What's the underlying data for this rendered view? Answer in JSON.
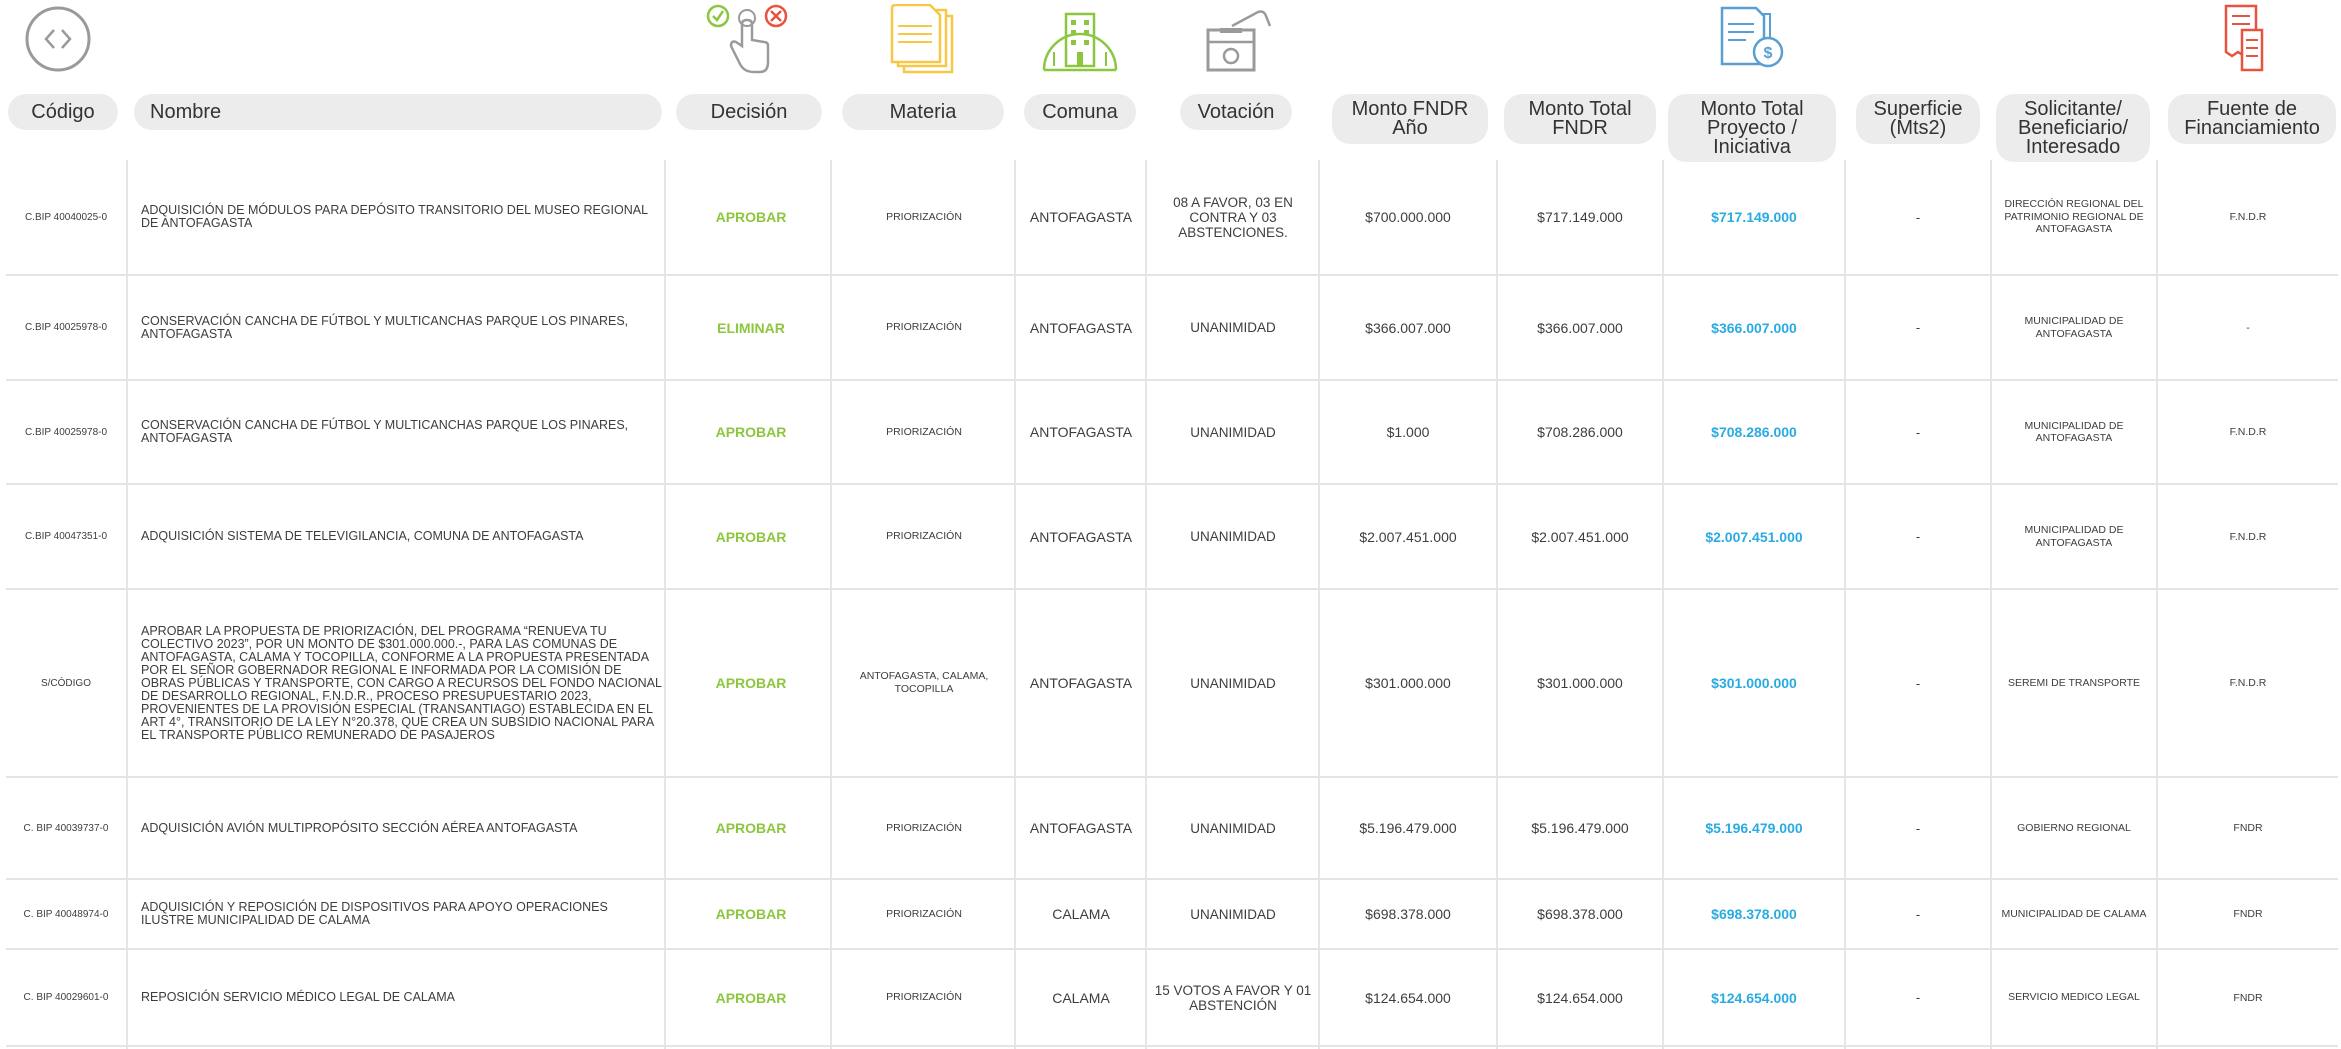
{
  "colors": {
    "decision": "#8cc63f",
    "total": "#29abe2",
    "pill": "#ececec",
    "icon_grey": "#9a9a9a",
    "icon_yellow": "#f7c846",
    "icon_green": "#8cc63f",
    "icon_blue": "#5a9fd4",
    "icon_red": "#e8533f"
  },
  "icons": [
    "code-brackets-icon",
    "decision-hand-icon",
    "documents-icon",
    "building-icon",
    "ballot-box-icon",
    "money-document-icon",
    "receipt-icon"
  ],
  "headers": {
    "codigo": "Código",
    "nombre": "Nombre",
    "decision": "Decisión",
    "materia": "Materia",
    "comuna": "Comuna",
    "votacion": "Votación",
    "monto_anio": "Monto FNDR\nAño",
    "monto_total": "Monto Total\nFNDR",
    "monto_proyecto": "Monto Total\nProyecto /\nIniciativa",
    "superficie": "Superficie\n(Mts2)",
    "solicitante": "Solicitante/\nBeneficiario/\nInteresado",
    "fuente": "Fuente de\nFinanciamiento"
  },
  "rows": [
    {
      "codigo": "C.BIP 40040025-0",
      "nombre": "ADQUISICIÓN DE MÓDULOS PARA DEPÓSITO TRANSITORIO DEL MUSEO REGIONAL DE ANTOFAGASTA",
      "decision": "APROBAR",
      "materia": "PRIORIZACIÓN",
      "comuna": "ANTOFAGASTA",
      "votacion": "08 A FAVOR, 03 EN CONTRA Y 03 ABSTENCIONES.",
      "monto_anio": "$700.000.000",
      "monto_total": "$717.149.000",
      "monto_proyecto": "$717.149.000",
      "superficie": "-",
      "solicitante": "DIRECCIÓN REGIONAL DEL PATRIMONIO REGIONAL DE ANTOFAGASTA",
      "fuente": "F.N.D.R"
    },
    {
      "codigo": "C.BIP 40025978-0",
      "nombre": "CONSERVACIÓN CANCHA DE FÚTBOL Y MULTICANCHAS PARQUE LOS PINARES, ANTOFAGASTA",
      "decision": "ELIMINAR",
      "materia": "PRIORIZACIÓN",
      "comuna": "ANTOFAGASTA",
      "votacion": "UNANIMIDAD",
      "monto_anio": "$366.007.000",
      "monto_total": "$366.007.000",
      "monto_proyecto": "$366.007.000",
      "superficie": "-",
      "solicitante": "MUNICIPALIDAD DE ANTOFAGASTA",
      "fuente": "-"
    },
    {
      "codigo": "C.BIP 40025978-0",
      "nombre": "CONSERVACIÓN CANCHA DE FÚTBOL Y MULTICANCHAS PARQUE LOS PINARES, ANTOFAGASTA",
      "decision": "APROBAR",
      "materia": "PRIORIZACIÓN",
      "comuna": "ANTOFAGASTA",
      "votacion": "UNANIMIDAD",
      "monto_anio": "$1.000",
      "monto_total": "$708.286.000",
      "monto_proyecto": "$708.286.000",
      "superficie": "-",
      "solicitante": "MUNICIPALIDAD DE ANTOFAGASTA",
      "fuente": "F.N.D.R"
    },
    {
      "codigo": "C.BIP 40047351-0",
      "nombre": "ADQUISICIÓN SISTEMA DE TELEVIGILANCIA, COMUNA DE ANTOFAGASTA",
      "decision": "APROBAR",
      "materia": "PRIORIZACIÓN",
      "comuna": "ANTOFAGASTA",
      "votacion": "UNANIMIDAD",
      "monto_anio": "$2.007.451.000",
      "monto_total": "$2.007.451.000",
      "monto_proyecto": "$2.007.451.000",
      "superficie": "-",
      "solicitante": "MUNICIPALIDAD DE ANTOFAGASTA",
      "fuente": "F.N.D.R"
    },
    {
      "codigo": "S/CÓDIGO",
      "nombre": "APROBAR LA PROPUESTA DE PRIORIZACIÓN, DEL PROGRAMA “RENUEVA TU COLECTIVO 2023”, POR UN MONTO DE $301.000.000.-, PARA LAS COMUNAS DE ANTOFAGASTA, CALAMA Y TOCOPILLA, CONFORME A LA PROPUESTA PRESENTADA POR EL SEÑOR GOBERNADOR REGIONAL E INFORMADA POR LA COMISIÓN DE OBRAS PÚBLICAS Y TRANSPORTE, CON CARGO A RECURSOS DEL FONDO NACIONAL DE DESARROLLO REGIONAL, F.N.D.R., PROCESO PRESUPUESTARIO 2023, PROVENIENTES DE LA PROVISIÓN ESPECIAL (TRANSANTIAGO) ESTABLECIDA EN EL ART 4°, TRANSITORIO DE LA LEY N°20.378, QUE CREA UN SUBSIDIO NACIONAL PARA EL TRANSPORTE PÚBLICO REMUNERADO DE PASAJEROS",
      "decision": "APROBAR",
      "materia": "ANTOFAGASTA, CALAMA, TOCOPILLA",
      "comuna": "ANTOFAGASTA",
      "votacion": "UNANIMIDAD",
      "monto_anio": "$301.000.000",
      "monto_total": "$301.000.000",
      "monto_proyecto": "$301.000.000",
      "superficie": "-",
      "solicitante": "SEREMI DE TRANSPORTE",
      "fuente": "F.N.D.R"
    },
    {
      "codigo": "C. BIP 40039737-0",
      "nombre": "ADQUISICIÓN AVIÓN MULTIPROPÓSITO SECCIÓN AÉREA ANTOFAGASTA",
      "decision": "APROBAR",
      "materia": "PRIORIZACIÓN",
      "comuna": "ANTOFAGASTA",
      "votacion": "UNANIMIDAD",
      "monto_anio": "$5.196.479.000",
      "monto_total": "$5.196.479.000",
      "monto_proyecto": "$5.196.479.000",
      "superficie": "-",
      "solicitante": "GOBIERNO REGIONAL",
      "fuente": "FNDR"
    },
    {
      "codigo": "C. BIP 40048974-0",
      "nombre": "ADQUISICIÓN Y REPOSICIÓN DE DISPOSITIVOS PARA APOYO OPERACIONES ILUSTRE MUNICIPALIDAD DE CALAMA",
      "decision": "APROBAR",
      "materia": "PRIORIZACIÓN",
      "comuna": "CALAMA",
      "votacion": "UNANIMIDAD",
      "monto_anio": "$698.378.000",
      "monto_total": "$698.378.000",
      "monto_proyecto": "$698.378.000",
      "superficie": "-",
      "solicitante": "MUNICIPALIDAD DE CALAMA",
      "fuente": "FNDR"
    },
    {
      "codigo": "C. BIP 40029601-0",
      "nombre": "REPOSICIÓN SERVICIO MÉDICO LEGAL DE CALAMA",
      "decision": "APROBAR",
      "materia": "PRIORIZACIÓN",
      "comuna": "CALAMA",
      "votacion": "15 VOTOS A FAVOR Y 01 ABSTENCIÓN",
      "monto_anio": "$124.654.000",
      "monto_total": "$124.654.000",
      "monto_proyecto": "$124.654.000",
      "superficie": "-",
      "solicitante": "SERVICIO MEDICO LEGAL",
      "fuente": "FNDR"
    }
  ]
}
